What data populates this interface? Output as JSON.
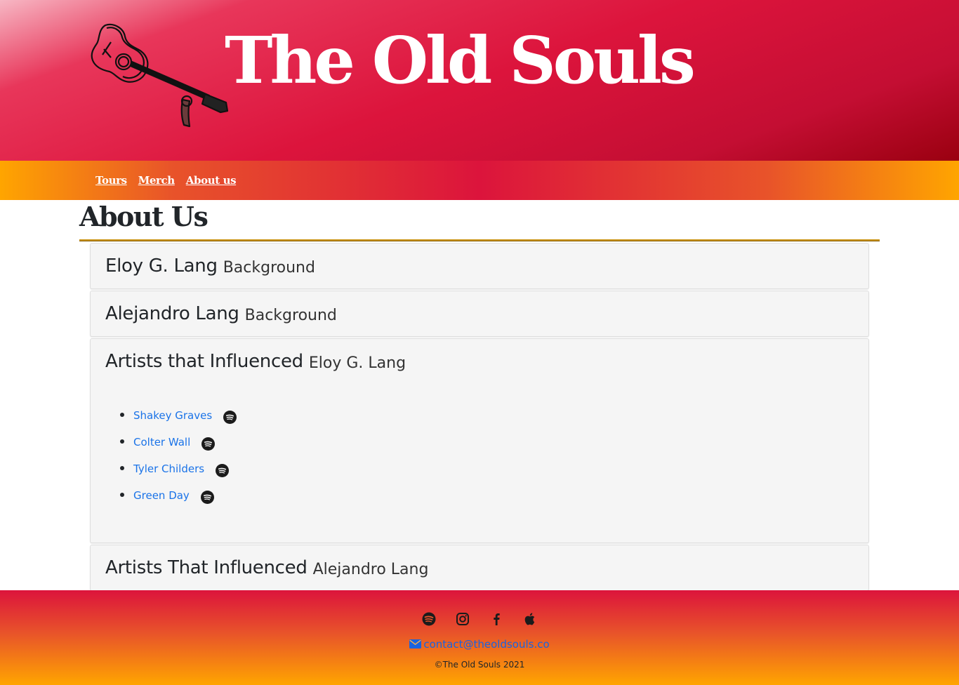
{
  "site": {
    "title": "The Old Souls",
    "brand_colors": {
      "header": "#dc143c",
      "nav_edge": "#ffa500",
      "link": "#1a73e8"
    }
  },
  "nav": {
    "items": [
      {
        "label": "Tours"
      },
      {
        "label": "Merch"
      },
      {
        "label": "About us"
      }
    ]
  },
  "page": {
    "heading": "About Us"
  },
  "accordion": {
    "items": [
      {
        "title": "Eloy G. Lang",
        "subtitle": "Background",
        "expanded": false
      },
      {
        "title": "Alejandro Lang",
        "subtitle": "Background",
        "expanded": false
      },
      {
        "title": "Artists that Influenced",
        "subtitle": "Eloy G. Lang",
        "expanded": true,
        "artists": [
          {
            "name": "Shakey Graves",
            "icon": "spotify-icon"
          },
          {
            "name": "Colter Wall",
            "icon": "spotify-icon"
          },
          {
            "name": "Tyler Childers",
            "icon": "spotify-icon"
          },
          {
            "name": "Green Day",
            "icon": "spotify-icon"
          }
        ]
      },
      {
        "title": "Artists That Influenced",
        "subtitle": "Alejandro Lang",
        "expanded": false
      }
    ]
  },
  "footer": {
    "social_icons": [
      "spotify-icon",
      "instagram-icon",
      "facebook-icon",
      "apple-icon"
    ],
    "contact_email": "contact@theoldsouls.co",
    "copyright": "©The Old Souls 2021"
  }
}
